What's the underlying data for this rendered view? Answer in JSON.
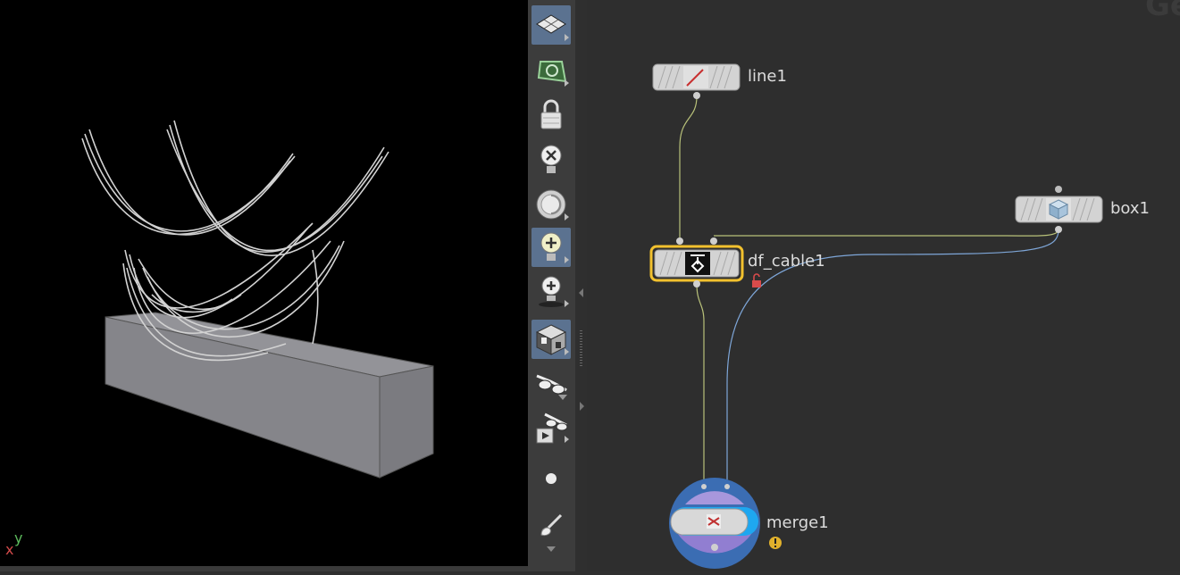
{
  "viewport": {
    "axis_x_label": "x",
    "axis_y_label": "y"
  },
  "toolbar": {
    "tools": [
      {
        "name": "display-options-tool"
      },
      {
        "name": "snapping-tool"
      },
      {
        "name": "lock-camera-tool"
      },
      {
        "name": "hide-lights-tool"
      },
      {
        "name": "headlight-tool"
      },
      {
        "name": "normal-lighting-tool"
      },
      {
        "name": "high-quality-lighting-tool"
      },
      {
        "name": "shading-mode-tool"
      },
      {
        "name": "stereo-view-tool"
      },
      {
        "name": "flipbook-tool"
      },
      {
        "name": "render-dot-tool"
      },
      {
        "name": "brush-tool"
      }
    ]
  },
  "network": {
    "watermark": "Geo",
    "nodes": {
      "line1": {
        "label": "line1"
      },
      "box1": {
        "label": "box1"
      },
      "df_cable1": {
        "label": "df_cable1",
        "selected": true,
        "locked_icon": "unlock-icon"
      },
      "merge1": {
        "label": "merge1",
        "warning_icon": "warning-icon"
      }
    },
    "colors": {
      "selected_outline": "#f2c12e",
      "wire_left": "#b9c27a",
      "wire_right": "#7ea6d8",
      "merge_bg": "#3b6db3"
    }
  }
}
